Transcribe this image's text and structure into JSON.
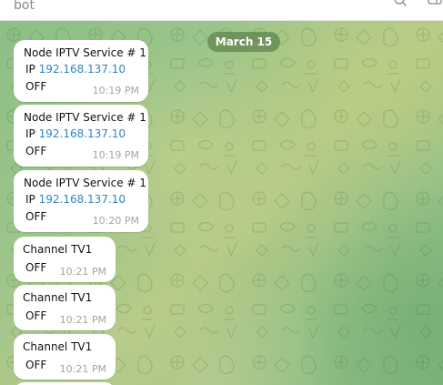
{
  "header": {
    "title": "bot",
    "icons": [
      "search-icon",
      "sidebar-icon"
    ]
  },
  "date_separator": "March 15",
  "messages": [
    {
      "title": "Node IPTV Service # 1",
      "ip_label": "IP",
      "ip": "192.168.137.10",
      "status": "OFF",
      "time": "10:19 PM"
    },
    {
      "title": "Node IPTV Service # 1",
      "ip_label": "IP",
      "ip": "192.168.137.10",
      "status": "OFF",
      "time": "10:19 PM"
    },
    {
      "title": "Node IPTV Service # 1",
      "ip_label": "IP",
      "ip": "192.168.137.10",
      "status": "OFF",
      "time": "10:20 PM"
    },
    {
      "title": "Channel TV1",
      "status": "OFF",
      "time": "10:21 PM"
    },
    {
      "title": "Channel TV1",
      "status": "OFF",
      "time": "10:21 PM"
    },
    {
      "title": "Channel TV1",
      "status": "OFF",
      "time": "10:21 PM"
    }
  ],
  "colors": {
    "link": "#2f86c4",
    "bubble": "#ffffff",
    "date_pill": "#5c824c",
    "timestamp": "#a0a6a0"
  }
}
